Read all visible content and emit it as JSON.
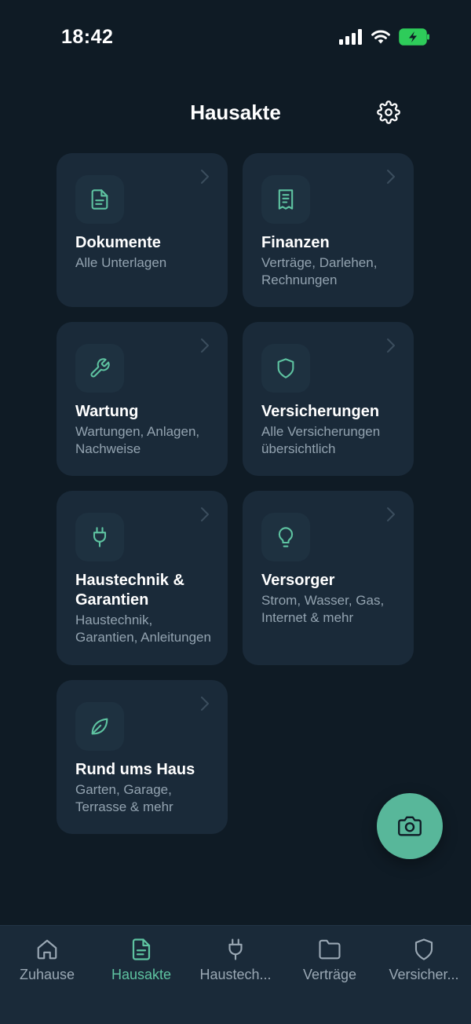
{
  "status_bar": {
    "time": "18:42"
  },
  "header": {
    "title": "Hausakte"
  },
  "colors": {
    "accent": "#5ec3a1",
    "background": "#0f1b25",
    "card": "#1a2a39",
    "fab": "#58b79a"
  },
  "cards": [
    {
      "title": "Dokumente",
      "subtitle": "Alle Unterlagen",
      "icon": "document-icon"
    },
    {
      "title": "Finanzen",
      "subtitle": "Verträge, Darlehen, Rechnungen",
      "icon": "receipt-icon"
    },
    {
      "title": "Wartung",
      "subtitle": "Wartungen, Anlagen, Nachweise",
      "icon": "wrench-icon"
    },
    {
      "title": "Versicherungen",
      "subtitle": "Alle Versicherungen übersichtlich",
      "icon": "shield-icon"
    },
    {
      "title": "Haustechnik & Garantien",
      "subtitle": "Haustechnik, Garantien, Anleitungen",
      "icon": "plug-icon"
    },
    {
      "title": "Versorger",
      "subtitle": "Strom, Wasser, Gas, Internet & mehr",
      "icon": "lightbulb-icon"
    },
    {
      "title": "Rund ums Haus",
      "subtitle": "Garten, Garage, Terrasse & mehr",
      "icon": "leaf-icon"
    }
  ],
  "tabs": [
    {
      "label": "Zuhause",
      "icon": "home-icon"
    },
    {
      "label": "Hausakte",
      "icon": "document-icon",
      "active": true
    },
    {
      "label": "Haustech...",
      "icon": "plug-icon"
    },
    {
      "label": "Verträge",
      "icon": "folder-icon"
    },
    {
      "label": "Versicher...",
      "icon": "shield-icon"
    }
  ]
}
